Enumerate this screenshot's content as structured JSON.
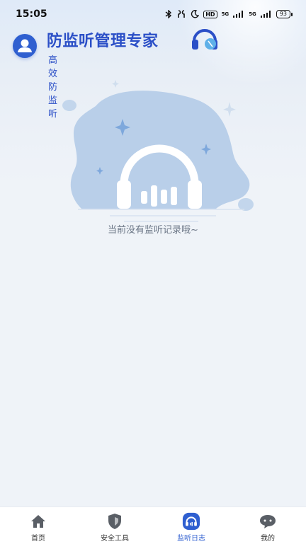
{
  "status_bar": {
    "time": "15:05",
    "network": "5G",
    "hd": "HD",
    "battery": "93"
  },
  "header": {
    "title": "防监听管理专家",
    "subtitle": "高效防监听"
  },
  "empty_state": {
    "message": "当前没有监听记录哦~"
  },
  "tabs": [
    {
      "label": "首页",
      "icon": "home-icon",
      "active": false
    },
    {
      "label": "安全工具",
      "icon": "shield-icon",
      "active": false
    },
    {
      "label": "监听日志",
      "icon": "headphones-icon",
      "active": true
    },
    {
      "label": "我的",
      "icon": "chat-bubble-icon",
      "active": false
    }
  ],
  "colors": {
    "accent": "#2f5fd0",
    "background": "#eff3f8",
    "illustration": "#b9cfe9"
  }
}
